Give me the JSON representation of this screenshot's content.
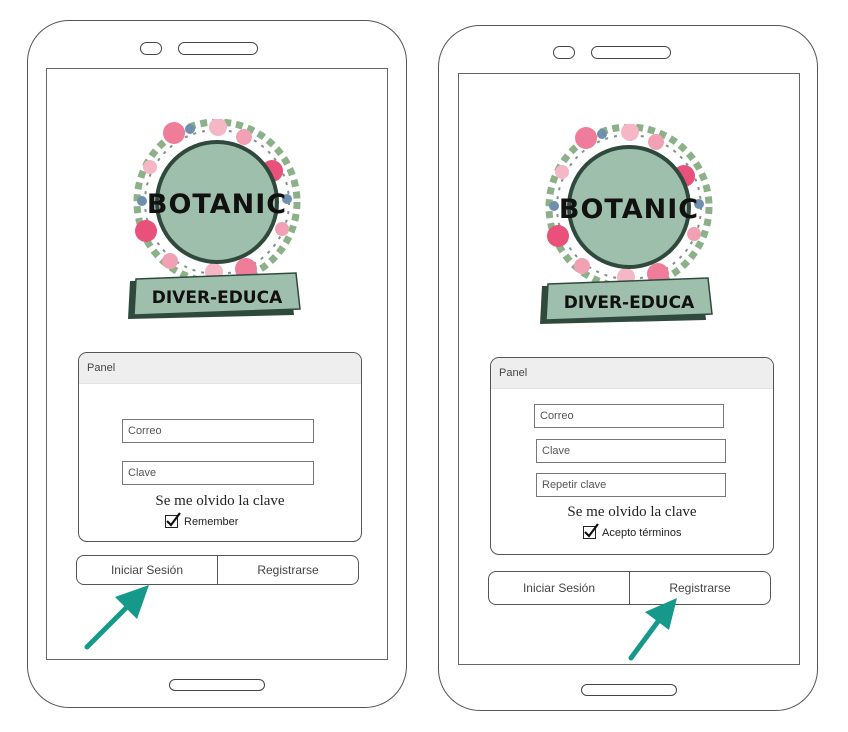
{
  "colors": {
    "logo_green": "#9fbfad",
    "logo_dark": "#2f4a3d",
    "arrow_teal": "#14998a",
    "flower_pink": "#e9507a"
  },
  "logo": {
    "title": "BOTANIC",
    "subtitle": "DIVER-EDUCA"
  },
  "login_screen": {
    "panel_title": "Panel",
    "email_placeholder": "Correo",
    "password_placeholder": "Clave",
    "forgot_label": "Se me olvido la clave",
    "remember_label": "Remember",
    "remember_checked": true,
    "login_button": "Iniciar Sesión",
    "register_button": "Registrarse",
    "highlighted_button": "login"
  },
  "register_screen": {
    "panel_title": "Panel",
    "email_placeholder": "Correo",
    "password_placeholder": "Clave",
    "repeat_password_placeholder": "Repetir clave",
    "forgot_label": "Se me olvido la clave",
    "terms_label": "Acepto términos",
    "terms_checked": true,
    "login_button": "Iniciar Sesión",
    "register_button": "Registrarse",
    "highlighted_button": "register"
  }
}
